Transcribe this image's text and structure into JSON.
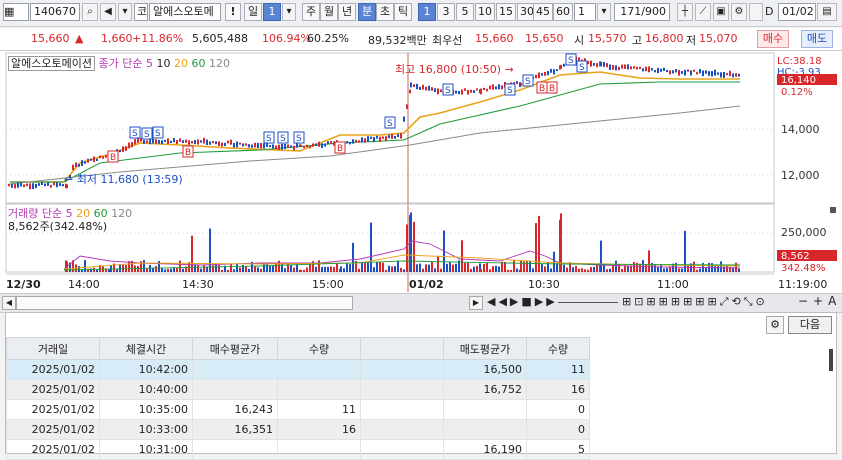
{
  "toolbar": {
    "code": "140670",
    "search_icon": "search-icon",
    "stock_type": "코",
    "stock_name": "알에스오토메",
    "period_label": "일",
    "period_num": "1",
    "periods": [
      "주",
      "월",
      "년",
      "분",
      "초",
      "틱"
    ],
    "active_period": "분",
    "intervals": [
      "1",
      "3",
      "5",
      "10",
      "15",
      "30",
      "45",
      "60"
    ],
    "active_interval": "1",
    "count": "1",
    "range": "171/900",
    "date_label": "D",
    "date": "01/02"
  },
  "quote": {
    "price": "15,660",
    "arrow": "▲",
    "change": "1,660",
    "pct": "+11.86%",
    "volume": "5,605,488",
    "vol_ratio": "106.94%",
    "turnover": "60.25%",
    "amount": "89,532백만",
    "best_label": "최우선",
    "best_ask": "15,660",
    "best_bid": "15,650",
    "open_label": "시",
    "open": "15,570",
    "high_label": "고",
    "high": "16,800",
    "low_label": "저",
    "low": "15,070",
    "buy": "매수",
    "sell": "매도"
  },
  "chart": {
    "name": "알에스오토메이션",
    "ma_label": "종가 단순",
    "ma": [
      "5",
      "10",
      "20",
      "60",
      "120"
    ],
    "lc": "LC:38.18",
    "hc": "HC:-3.93",
    "price_tag": "16,140",
    "price_pct": "0.12%",
    "y_ticks": [
      "14,000",
      "12,000"
    ],
    "max_label": "최고 16,800 (10:50) →",
    "min_label": "← 최저 11,680 (13:59)",
    "vol_title": "거래량 단순",
    "vol_ma": [
      "5",
      "20",
      "60",
      "120"
    ],
    "vol_text": "8,562주(342.48%)",
    "vol_tick": "250,000",
    "vol_tag": "8,562",
    "vol_pct": "342.48%",
    "x_labels": [
      "12/30",
      "14:00",
      "14:30",
      "15:00",
      "01/02",
      "10:30",
      "11:00",
      "11:19:00"
    ]
  },
  "chart_data": {
    "type": "line",
    "series": [
      {
        "name": "종가",
        "points": [
          [
            "13:40",
            11720
          ],
          [
            "13:59",
            11680
          ],
          [
            "14:05",
            12450
          ],
          [
            "14:15",
            12900
          ],
          [
            "14:25",
            13500
          ],
          [
            "14:40",
            13450
          ],
          [
            "14:55",
            13300
          ],
          [
            "15:05",
            13250
          ],
          [
            "15:15",
            13350
          ],
          [
            "15:25",
            13550
          ],
          [
            "15:29",
            13700
          ],
          [
            "09:00",
            15700
          ],
          [
            "09:10",
            15550
          ],
          [
            "09:25",
            15400
          ],
          [
            "09:40",
            15550
          ],
          [
            "10:00",
            15800
          ],
          [
            "10:15",
            16150
          ],
          [
            "10:30",
            16450
          ],
          [
            "10:50",
            16800
          ],
          [
            "11:00",
            16400
          ],
          [
            "11:10",
            16200
          ],
          [
            "11:19",
            16140
          ]
        ]
      }
    ],
    "ylim": [
      11000,
      17000
    ]
  },
  "buttons": {
    "next": "다음"
  },
  "table": {
    "headers": [
      "거래일",
      "체결시간",
      "매수평균가",
      "수량",
      "",
      "매도평균가",
      "수량"
    ],
    "rows": [
      [
        "2025/01/02",
        "10:42:00",
        "",
        "",
        "",
        "16,500",
        "11"
      ],
      [
        "2025/01/02",
        "10:40:00",
        "",
        "",
        "",
        "16,752",
        "16"
      ],
      [
        "2025/01/02",
        "10:35:00",
        "16,243",
        "11",
        "",
        "",
        "0"
      ],
      [
        "2025/01/02",
        "10:33:00",
        "16,351",
        "16",
        "",
        "",
        "0"
      ],
      [
        "2025/01/02",
        "10:31:00",
        "",
        "",
        "",
        "16,190",
        "5"
      ]
    ]
  }
}
